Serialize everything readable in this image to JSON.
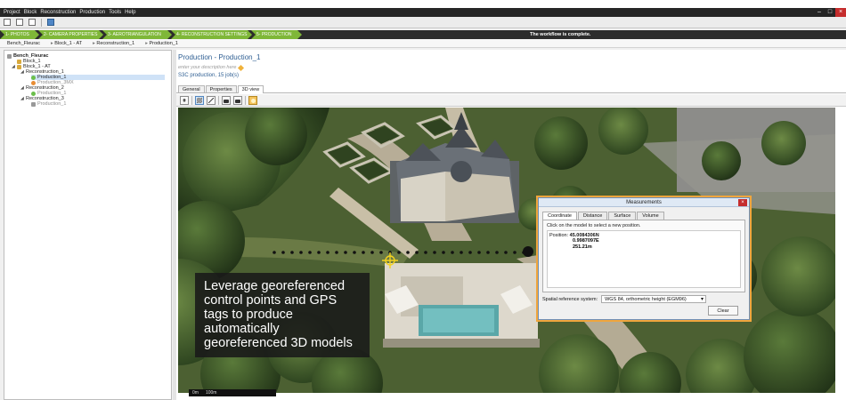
{
  "menu": [
    "Project",
    "Block",
    "Reconstruction",
    "Production",
    "Tools",
    "Help"
  ],
  "window_controls": [
    "–",
    "□",
    "×"
  ],
  "workflow": {
    "steps": [
      "1- PHOTOS",
      "2- CAMERA PROPERTIES",
      "3- AEROTRIANGULATION",
      "4- RECONSTRUCTION SETTINGS",
      "5- PRODUCTION"
    ],
    "status": "The workflow is complete.",
    "active_color": "#7fb738"
  },
  "breadcrumb": [
    "Bench_Fleurac",
    "Block_1 - AT",
    "Reconstruction_1",
    "Production_1"
  ],
  "tree": {
    "items": [
      {
        "label": "Bench_Fleurac"
      },
      {
        "label": "Block_1"
      },
      {
        "label": "Block_1 - AT"
      },
      {
        "label": "Reconstruction_1"
      },
      {
        "label": "Production_1"
      },
      {
        "label": "Production_3MX"
      },
      {
        "label": "Reconstruction_2"
      },
      {
        "label": "Production_1"
      },
      {
        "label": "Reconstruction_3"
      },
      {
        "label": "Production_1"
      }
    ]
  },
  "detail": {
    "title": "Production - Production_1",
    "description_placeholder": "enter your description here",
    "summary": "S3C production, 15 job(s)",
    "tabs": [
      "General",
      "Properties",
      "3D view"
    ]
  },
  "viewport": {
    "scalebar": [
      "0m",
      "100m"
    ]
  },
  "overlay": {
    "text": "Leverage georeferenced control points and GPS tags to produce automatically georeferenced 3D models"
  },
  "measurements": {
    "title": "Measurements",
    "tabs": [
      "Coordinate",
      "Distance",
      "Surface",
      "Volume"
    ],
    "instruction": "Click on the model to select a new position.",
    "position_label": "Position:",
    "position": [
      "45.0084306N",
      "0.9987097E",
      "251.21m"
    ],
    "srs_label": "Spatial reference system:",
    "srs_value": "WGS 84, orthometric height (EGM96)",
    "clear_label": "Clear",
    "highlight_color": "#f0a63d"
  }
}
